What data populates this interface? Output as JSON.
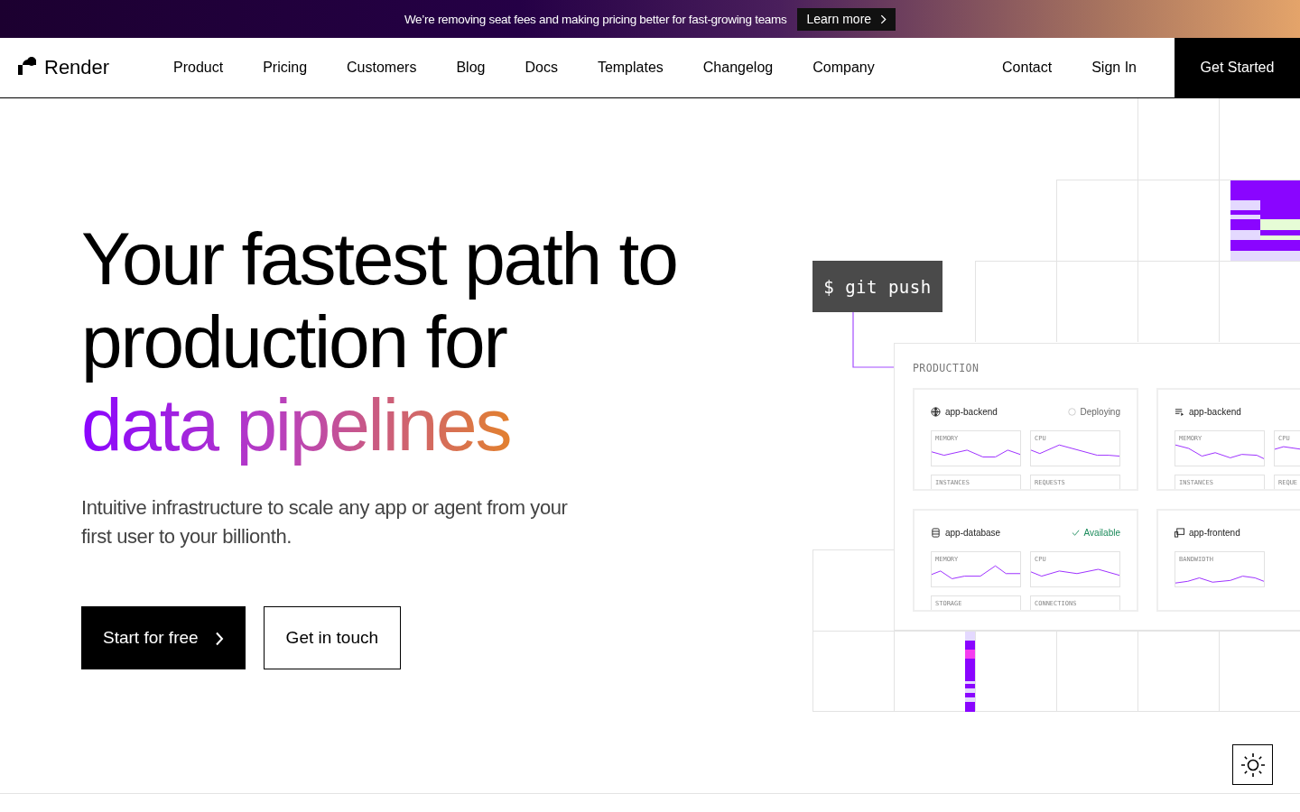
{
  "banner": {
    "text": "We’re removing seat fees and making pricing better for fast-growing teams",
    "link": "Learn more"
  },
  "nav": {
    "brand": "Render",
    "links": [
      "Product",
      "Pricing",
      "Customers",
      "Blog",
      "Docs",
      "Templates",
      "Changelog",
      "Company"
    ],
    "right_links": [
      "Contact",
      "Sign In"
    ],
    "cta": "Get Started"
  },
  "hero": {
    "headline": [
      "Your fastest path to",
      "production for"
    ],
    "highlight": "data pipelines",
    "subtitle": "Intuitive infrastructure to scale any app or agent from your first user to your billionth.",
    "buttons": [
      {
        "label": "Start for free",
        "kind": "primary"
      },
      {
        "label": "Get in touch",
        "kind": "secondary"
      }
    ]
  },
  "illustration": {
    "command": "$ git push",
    "environment": "PRODUCTION",
    "services": [
      {
        "name": "app-backend",
        "kind": "web",
        "status": {
          "kind": "deploying",
          "label": "Deploying"
        },
        "metrics": [
          "MEMORY",
          "CPU",
          "INSTANCES",
          "REQUESTS"
        ]
      },
      {
        "name": "app-backend",
        "kind": "worker",
        "metrics": [
          "MEMORY",
          "CPU",
          "INSTANCES",
          "REQUE"
        ]
      },
      {
        "name": "app-database",
        "kind": "database",
        "status": {
          "kind": "available",
          "label": "Available"
        },
        "metrics": [
          "MEMORY",
          "CPU",
          "STORAGE",
          "CONNECTIONS"
        ]
      },
      {
        "name": "app-frontend",
        "kind": "static",
        "metrics": [
          "BANDWIDTH"
        ]
      }
    ]
  }
}
